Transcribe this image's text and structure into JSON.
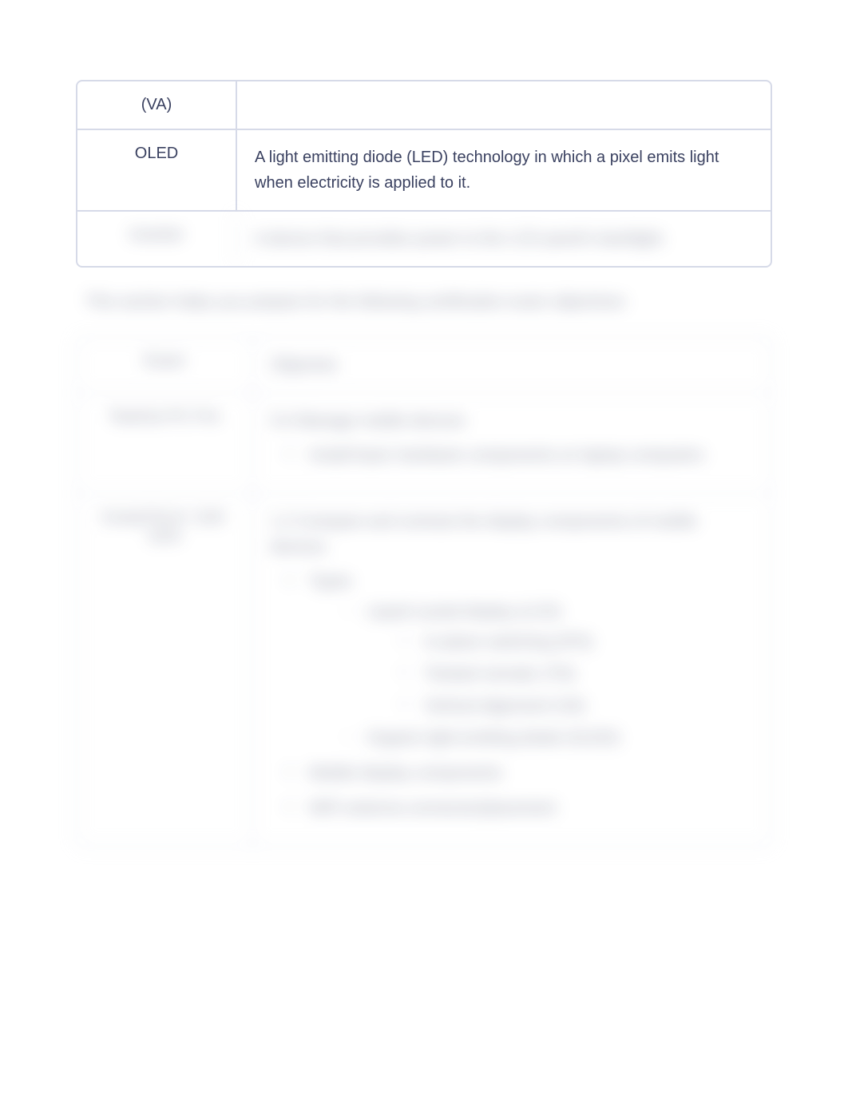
{
  "table1": {
    "rows": [
      {
        "term": "(VA)",
        "definition": ""
      },
      {
        "term": "OLED",
        "definition": "A light emitting diode (LED) technology in which a pixel emits light when electricity is applied to it."
      },
      {
        "term": "Inverter",
        "definition": "A device that provides power to the LCD panel's backlight."
      }
    ]
  },
  "intro": "This section helps you prepare for the following certification exam objectives:",
  "table2": {
    "header": {
      "left": "Exam",
      "right": "Objective"
    },
    "rows": [
      {
        "left": "TestOut PC Pro",
        "right": {
          "heading": "5.0 Manage mobile devices",
          "bullets": [
            "Install basic hardware components on laptop computers"
          ]
        }
      },
      {
        "left": "CompTIA A+ 220-1101",
        "right": {
          "heading": "1.2 Compare and contrast the display components of mobile devices.",
          "bullets_alpha": [
            {
              "label": "Types",
              "sub": [
                {
                  "label": "Liquid crystal display (LCD)",
                  "deep": [
                    "In-plane switching (IPS)",
                    "Twisted nematic (TN)",
                    "Vertical alignment (VA)"
                  ]
                },
                {
                  "label": "Organic light-emitting diode (OLED)"
                }
              ]
            },
            {
              "label": "Mobile display components"
            },
            {
              "label": "WiFi antenna connector/placement"
            }
          ]
        }
      }
    ]
  }
}
